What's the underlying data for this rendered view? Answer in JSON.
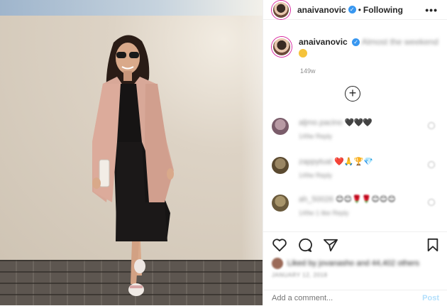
{
  "post": {
    "username": "anaivanovic",
    "separator": "•",
    "follow_status": "Following",
    "more_label": "•••"
  },
  "caption": {
    "username": "anaivanovic",
    "text": "Almost the weekend",
    "timestamp": "149w"
  },
  "comments": [
    {
      "user": "aljmo.pacino",
      "text": "🖤🖤🖤",
      "meta": "149w   Reply",
      "avatar_color": "#8a6e7b"
    },
    {
      "user": "zappytual",
      "text": "❤️🙏🏆💎",
      "meta": "149w   Reply",
      "avatar_color": "#6b5a3e"
    },
    {
      "user": "ah_50026",
      "text": "😊😊🌹🌹😊😊😊",
      "meta": "149w   1 like   Reply",
      "avatar_color": "#7a6a4a"
    }
  ],
  "likes": {
    "text": "Liked by jovanasho and 44,402 others",
    "date": "JANUARY 12, 2018"
  },
  "add_comment": {
    "placeholder": "Add a comment...",
    "post_label": "Post"
  },
  "icons": [
    "heart-icon",
    "comment-icon",
    "share-icon",
    "bookmark-icon",
    "plus-circle-icon",
    "verified-icon",
    "more-options-icon"
  ],
  "colors": {
    "accent": "#3897f0",
    "post_disabled": "#b2dffc",
    "ring": "#d6249f"
  }
}
